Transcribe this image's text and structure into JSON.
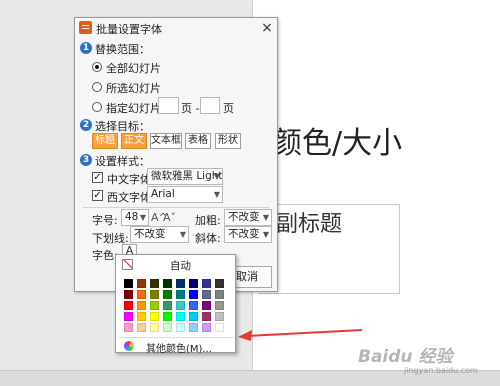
{
  "slide": {
    "title_text": "颜色/大小",
    "subtitle_text": "副标题"
  },
  "dialog": {
    "title": "批量设置字体",
    "close_glyph": "×",
    "section1": {
      "number": "1",
      "label": "替换范围："
    },
    "range": {
      "all": "全部幻灯片",
      "selected": "所选幻灯片",
      "specified": "指定幻灯片",
      "page": "页 -",
      "page_end": "页",
      "current": "all"
    },
    "section2": {
      "number": "2",
      "label": "选择目标："
    },
    "targets": [
      {
        "label": "标题",
        "selected": true
      },
      {
        "label": "正文",
        "selected": true
      },
      {
        "label": "文本框",
        "selected": false
      },
      {
        "label": "表格",
        "selected": false
      },
      {
        "label": "形状",
        "selected": false
      }
    ],
    "section3": {
      "number": "3",
      "label": "设置样式："
    },
    "cn_font": {
      "checked": true,
      "label": "中文字体",
      "value": "微软雅黑 Light"
    },
    "west_font": {
      "checked": true,
      "label": "西文字体",
      "value": "Arial"
    },
    "size": {
      "label": "字号:",
      "value": "48",
      "grow_glyph": "A^",
      "shrink_glyph": "A˅"
    },
    "bold": {
      "label": "加粗:",
      "value": "不改变"
    },
    "underline": {
      "label": "下划线:",
      "value": "不改变"
    },
    "italic": {
      "label": "斜体:",
      "value": "不改变"
    },
    "color": {
      "label": "字色:",
      "glyph": "A"
    },
    "cancel_button": "取消"
  },
  "color_popup": {
    "auto_label": "自动",
    "more_label": "其他颜色(M)...",
    "rows": [
      [
        "#000000",
        "#993300",
        "#333300",
        "#003300",
        "#003366",
        "#000080",
        "#333399",
        "#333333"
      ],
      [
        "#800000",
        "#ff6600",
        "#808000",
        "#008000",
        "#008080",
        "#0000ff",
        "#666699",
        "#808080"
      ],
      [
        "#ff0000",
        "#ff9900",
        "#99cc00",
        "#339966",
        "#33cccc",
        "#3366ff",
        "#800080",
        "#969696"
      ],
      [
        "#ff00ff",
        "#ffcc00",
        "#ffff00",
        "#00ff00",
        "#00ffff",
        "#00ccff",
        "#993366",
        "#c0c0c0"
      ],
      [
        "#ff99cc",
        "#ffcc99",
        "#ffff99",
        "#ccffcc",
        "#ccffff",
        "#99ccff",
        "#cc99ff",
        "#ffffff"
      ]
    ]
  },
  "annotation": {
    "arrow_color": "#e53935"
  },
  "watermark": {
    "text": "Baidu 经验",
    "sub": "jingyan.baidu.com"
  }
}
